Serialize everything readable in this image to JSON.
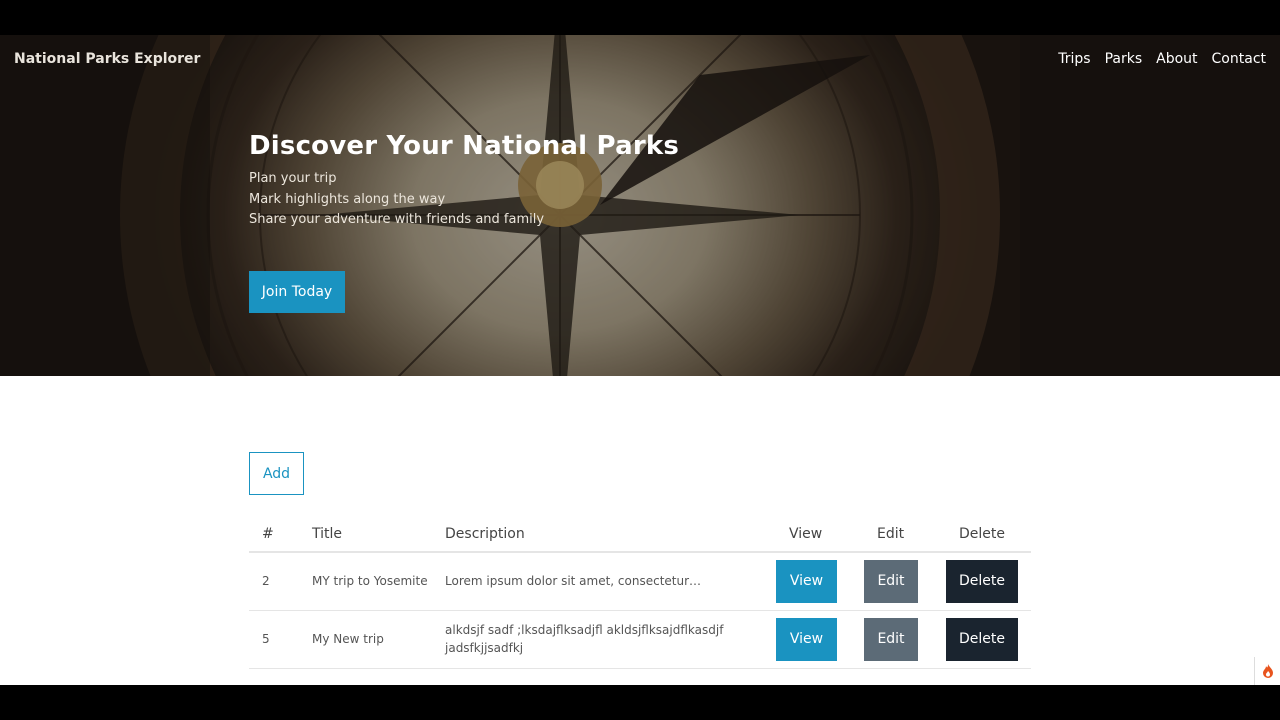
{
  "nav": {
    "brand": "National Parks Explorer",
    "links": [
      "Trips",
      "Parks",
      "About",
      "Contact"
    ]
  },
  "hero": {
    "title": "Discover Your National Parks",
    "lines": [
      "Plan your trip",
      "Mark highlights along the way",
      "Share your adventure with friends and family"
    ],
    "cta_label": "Join Today"
  },
  "actions": {
    "add_label": "Add"
  },
  "table": {
    "headers": [
      "#",
      "Title",
      "Description",
      "View",
      "Edit",
      "Delete"
    ],
    "rows": [
      {
        "id": "2",
        "title": "MY trip to Yosemite",
        "description": "Lorem ipsum dolor sit amet, consectetur…"
      },
      {
        "id": "5",
        "title": "My New trip",
        "description": "alkdsjf sadf ;lksdajflksadjfl akldsjflksajdflkasdjf jadsfkjjsadfkj"
      }
    ],
    "view_label": "View",
    "edit_label": "Edit",
    "delete_label": "Delete"
  },
  "colors": {
    "primary": "#1a93c1",
    "secondary": "#5c6b77",
    "dark": "#1a242f"
  },
  "icons": {
    "floating": "flame-icon"
  }
}
